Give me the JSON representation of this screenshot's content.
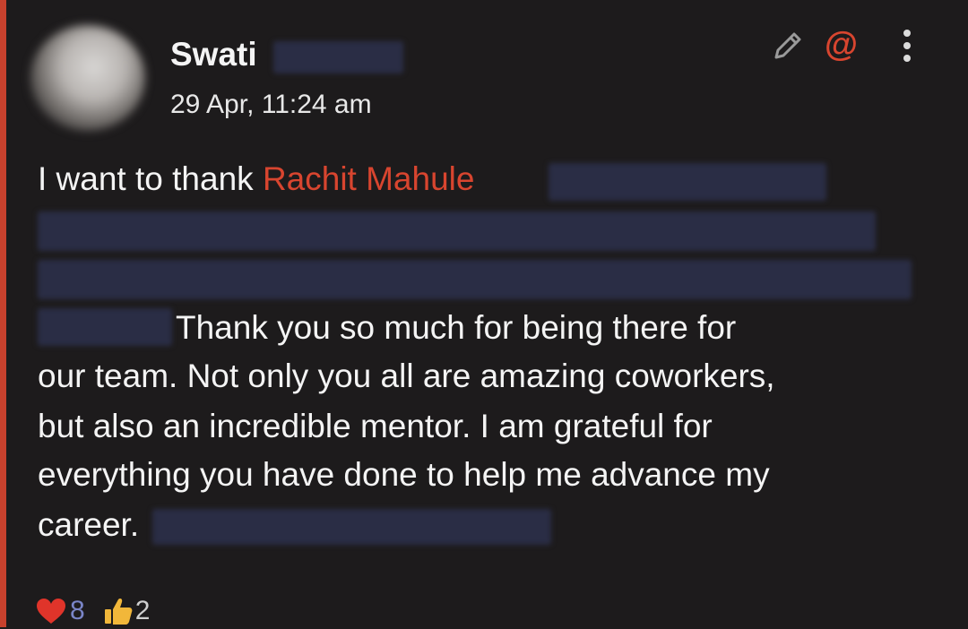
{
  "post": {
    "author_name": "Swati",
    "timestamp": "29 Apr, 11:24 am",
    "mention": "Rachit Mahule",
    "message_intro": "I want to thank",
    "message_lines": [
      "Thank you so much for being there for",
      "our team. Not only you all are amazing coworkers,",
      "but also an incredible mentor. I am grateful for",
      "everything you have done to help me advance my",
      "career."
    ]
  },
  "actions": {
    "edit_icon": "pencil-icon",
    "mention_icon": "at-icon",
    "mention_symbol": "@",
    "more_icon": "kebab-menu-icon"
  },
  "reactions": {
    "heart_count": "8",
    "like_count": "2"
  },
  "colors": {
    "background": "#1d1b1c",
    "accent": "#c8412d",
    "mention": "#d8452f",
    "text": "#f4f4f4"
  }
}
